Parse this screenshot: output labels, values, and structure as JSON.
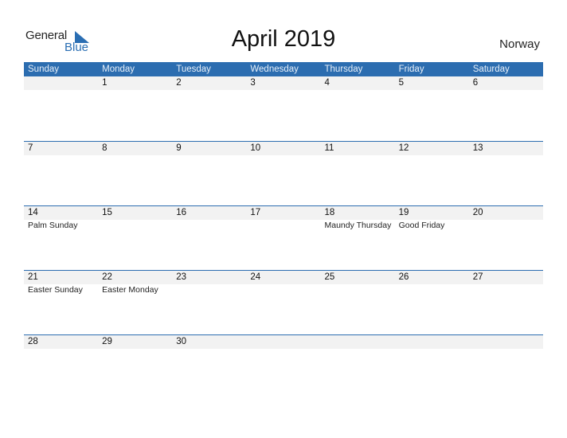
{
  "logo": {
    "word1": "General",
    "word2": "Blue",
    "icon": "triangle-flag-icon"
  },
  "title": "April 2019",
  "country": "Norway",
  "colors": {
    "header_bg": "#2c6db0",
    "date_strip_bg": "#f2f2f2",
    "logo_blue": "#2a6eb3"
  },
  "weekdays": [
    "Sunday",
    "Monday",
    "Tuesday",
    "Wednesday",
    "Thursday",
    "Friday",
    "Saturday"
  ],
  "weeks": [
    {
      "days": [
        "",
        "1",
        "2",
        "3",
        "4",
        "5",
        "6"
      ],
      "events": [
        "",
        "",
        "",
        "",
        "",
        "",
        ""
      ]
    },
    {
      "days": [
        "7",
        "8",
        "9",
        "10",
        "11",
        "12",
        "13"
      ],
      "events": [
        "",
        "",
        "",
        "",
        "",
        "",
        ""
      ]
    },
    {
      "days": [
        "14",
        "15",
        "16",
        "17",
        "18",
        "19",
        "20"
      ],
      "events": [
        "Palm Sunday",
        "",
        "",
        "",
        "Maundy Thursday",
        "Good Friday",
        ""
      ]
    },
    {
      "days": [
        "21",
        "22",
        "23",
        "24",
        "25",
        "26",
        "27"
      ],
      "events": [
        "Easter Sunday",
        "Easter Monday",
        "",
        "",
        "",
        "",
        ""
      ]
    },
    {
      "days": [
        "28",
        "29",
        "30",
        "",
        "",
        "",
        ""
      ],
      "events": [
        "",
        "",
        "",
        "",
        "",
        "",
        ""
      ]
    }
  ]
}
